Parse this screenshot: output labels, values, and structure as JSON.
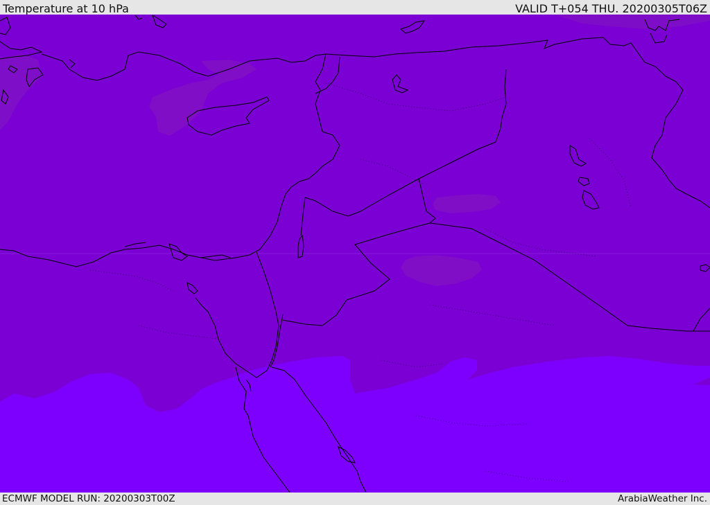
{
  "header": {
    "title": "Temperature at 10 hPa",
    "valid": "VALID T+054 THU. 20200305T06Z"
  },
  "footer": {
    "model_run": "ECMWF MODEL RUN: 20200303T00Z",
    "credit": "ArabiaWeather Inc."
  },
  "colors": {
    "background_band": "#7a00d4",
    "southern_band": "#7d00ff",
    "warm_patch": "#7f10c4",
    "coastline": "#000000",
    "frame": "#e6e6e6"
  }
}
